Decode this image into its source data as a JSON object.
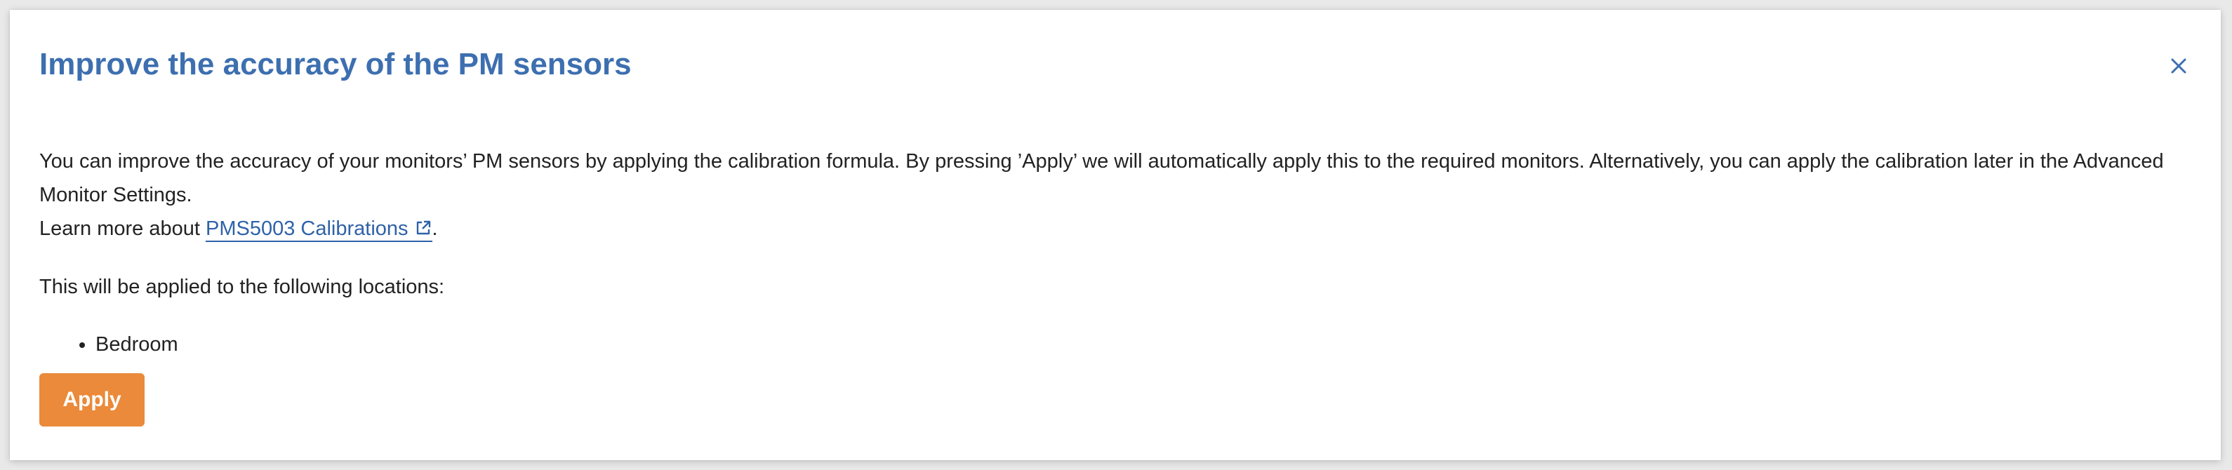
{
  "dialog": {
    "title": "Improve the accuracy of the PM sensors",
    "close_icon": "close-icon",
    "description": "You can improve the accuracy of your monitors’ PM sensors by applying the calibration formula. By pressing ’Apply’ we will automatically apply this to the required monitors. Alternatively, you can apply the calibration later in the Advanced Monitor Settings.",
    "learn_more_prefix": "Learn more about ",
    "learn_more_link": "PMS5003 Calibrations",
    "external_link_icon": "external-link-icon",
    "learn_more_suffix": ".",
    "locations_intro": "This will be applied to the following locations:",
    "locations": [
      "Bedroom"
    ],
    "apply_label": "Apply"
  },
  "colors": {
    "title": "#3d6fb0",
    "link": "#2f62a8",
    "apply_button": "#ea8a3a",
    "text": "#222222"
  }
}
